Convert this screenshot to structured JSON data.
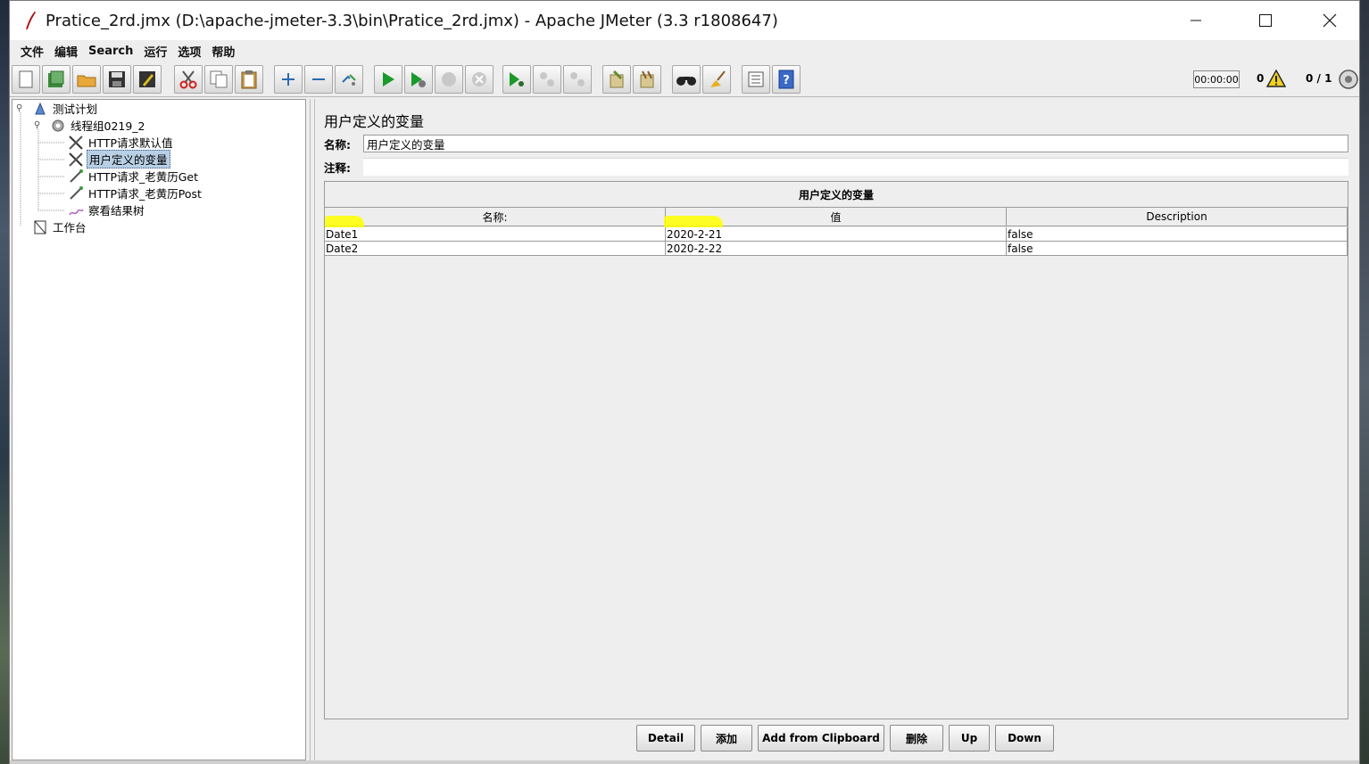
{
  "window": {
    "title": "Pratice_2rd.jmx (D:\\apache-jmeter-3.3\\bin\\Pratice_2rd.jmx) - Apache JMeter (3.3 r1808647)"
  },
  "menu": [
    "文件",
    "编辑",
    "Search",
    "运行",
    "选项",
    "帮助"
  ],
  "toolbar": {
    "icons": [
      "new-icon",
      "templates-icon",
      "open-icon",
      "save-icon",
      "save-as-icon",
      "cut-icon",
      "copy-icon",
      "paste-icon",
      "expand-icon",
      "collapse-icon",
      "toggle-icon",
      "start-icon",
      "start-no-pause-icon",
      "stop-icon",
      "shutdown-icon",
      "remote-start-icon",
      "remote-stop-icon",
      "remote-shutdown-icon",
      "clear-icon",
      "clear-all-icon",
      "search-icon",
      "reset-search-icon",
      "function-helper-icon",
      "help-icon"
    ],
    "timer": "00:00:00",
    "warning_count": "0",
    "threads": "0 / 1"
  },
  "tree": [
    {
      "label": "测试计划",
      "icon": "test-plan-icon",
      "selected": false
    },
    {
      "label": "线程组0219_2",
      "icon": "thread-group-icon",
      "selected": false
    },
    {
      "label": "HTTP请求默认值",
      "icon": "config-element-icon",
      "selected": false
    },
    {
      "label": "用户定义的变量",
      "icon": "config-element-icon",
      "selected": true
    },
    {
      "label": "HTTP请求_老黄历Get",
      "icon": "sampler-icon",
      "selected": false
    },
    {
      "label": "HTTP请求_老黄历Post",
      "icon": "sampler-icon",
      "selected": false
    },
    {
      "label": "察看结果树",
      "icon": "listener-icon",
      "selected": false
    },
    {
      "label": "工作台",
      "icon": "workbench-icon",
      "selected": false
    }
  ],
  "panel": {
    "title": "用户定义的变量",
    "name_label": "名称:",
    "name_value": "用户定义的变量",
    "comment_label": "注释:",
    "comment_value": "",
    "table_caption": "用户定义的变量",
    "columns": [
      "名称:",
      "值",
      "Description"
    ],
    "rows": [
      {
        "name": "Date1",
        "value": "2020-2-21",
        "description": "false"
      },
      {
        "name": "Date2",
        "value": "2020-2-22",
        "description": "false"
      }
    ],
    "highlight_color": "#ffff00"
  },
  "buttons": [
    "Detail",
    "添加",
    "Add from Clipboard",
    "删除",
    "Up",
    "Down"
  ]
}
